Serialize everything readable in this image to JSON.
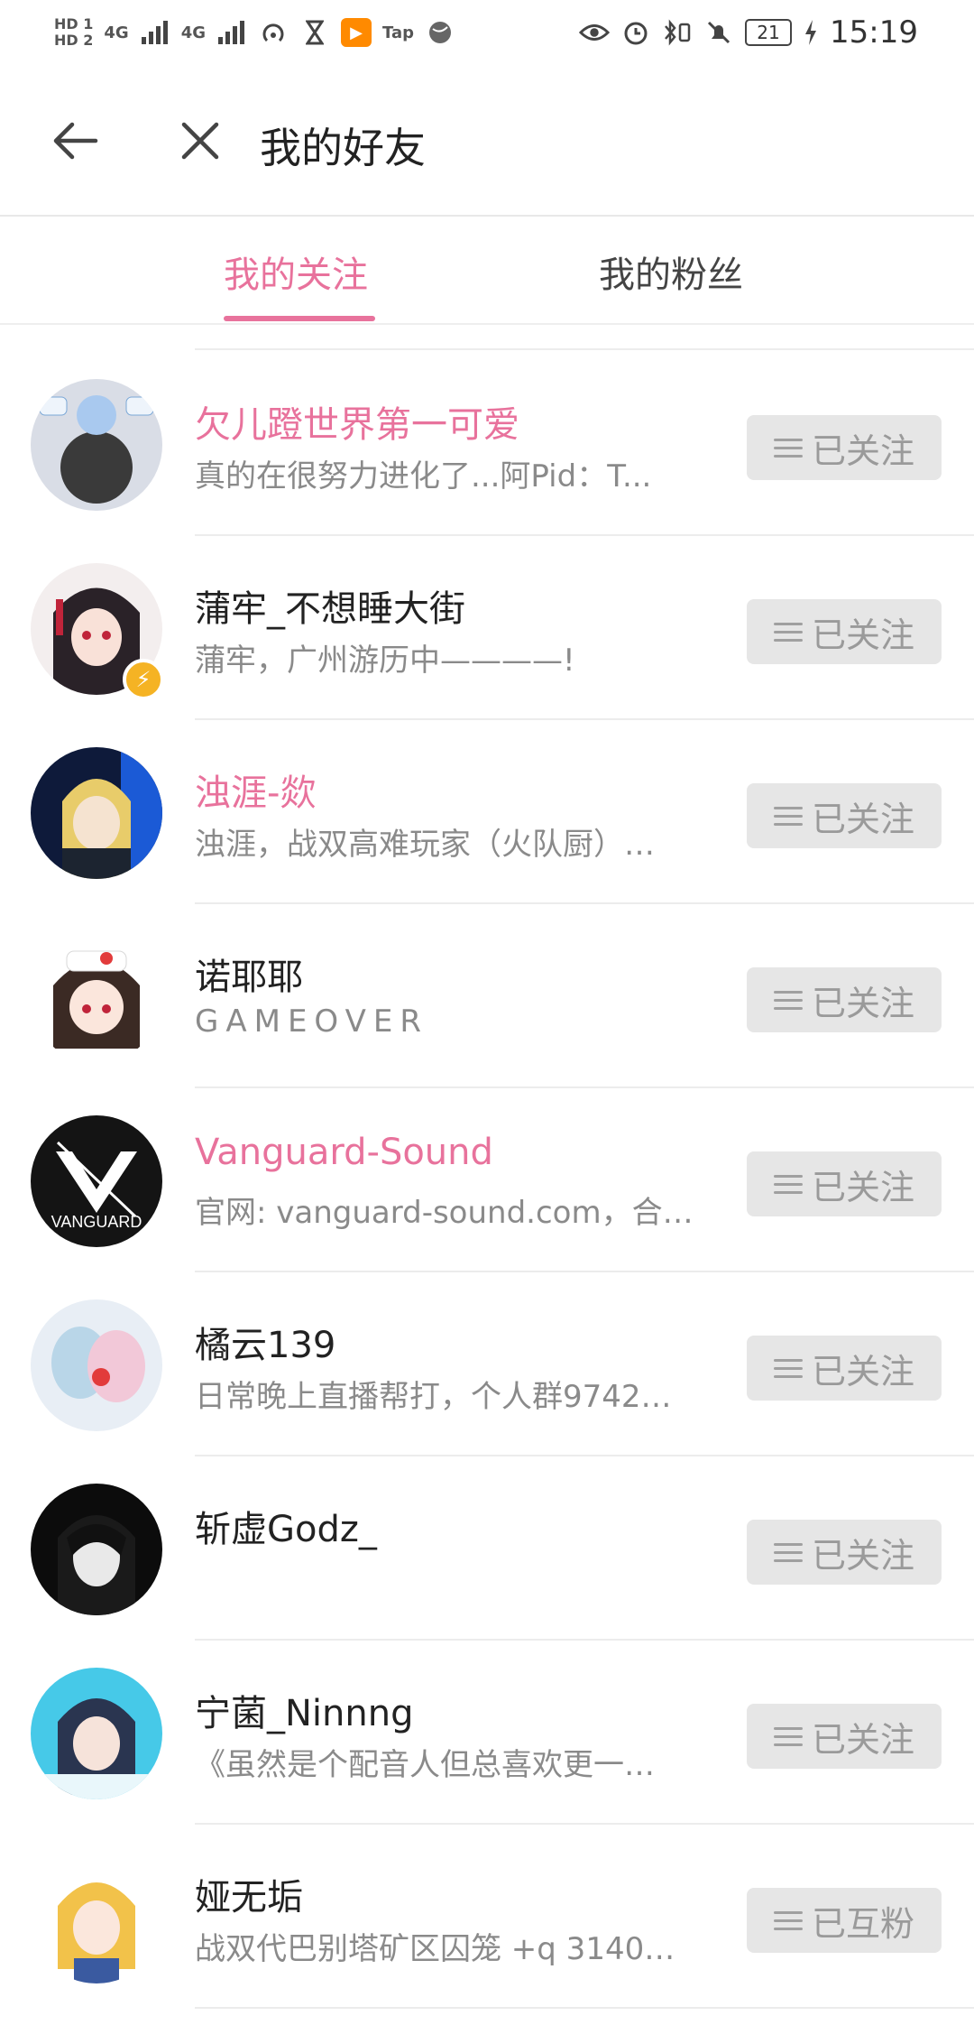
{
  "status_bar": {
    "sim1": "HD 1",
    "sim2": "HD 2",
    "network1": "4G",
    "network2": "4G",
    "tap_label": "Tap",
    "battery": "21",
    "time": "15:19"
  },
  "header": {
    "title": "我的好友"
  },
  "tabs": [
    {
      "label": "我的关注",
      "active": true
    },
    {
      "label": "我的粉丝",
      "active": false
    }
  ],
  "colors": {
    "accent": "#e8729c",
    "vip_badge": "#f5b324"
  },
  "users": [
    {
      "name": "欠儿蹬世界第一可爱",
      "desc": "真的在很努力进化了...阿Pid：T...",
      "button": "已关注",
      "vip_name": true,
      "badge": false
    },
    {
      "name": "蒲牢_不想睡大街",
      "desc": "蒲牢，广州游历中————!",
      "button": "已关注",
      "vip_name": false,
      "badge": true
    },
    {
      "name": "浊涯-欻",
      "desc": "浊涯，战双高难玩家（火队厨）…",
      "button": "已关注",
      "vip_name": true,
      "badge": false
    },
    {
      "name": "诺耶耶",
      "desc": "GAMEOVER",
      "button": "已关注",
      "vip_name": false,
      "badge": false
    },
    {
      "name": "Vanguard-Sound",
      "desc": "官网: vanguard-sound.com，合…",
      "button": "已关注",
      "vip_name": true,
      "badge": false
    },
    {
      "name": "橘云139",
      "desc": "日常晚上直播帮打，个人群9742…",
      "button": "已关注",
      "vip_name": false,
      "badge": false
    },
    {
      "name": "斩虚Godz_",
      "desc": "",
      "button": "已关注",
      "vip_name": false,
      "badge": false
    },
    {
      "name": "宁菌_Ninnng",
      "desc": "《虽然是个配音人但总喜欢更一…",
      "button": "已关注",
      "vip_name": false,
      "badge": false
    },
    {
      "name": "娅无垢",
      "desc": "战双代巴别塔矿区囚笼 +q 3140…",
      "button": "已互粉",
      "vip_name": false,
      "badge": false
    }
  ],
  "vanguard_logo_text": "VANGUARD"
}
